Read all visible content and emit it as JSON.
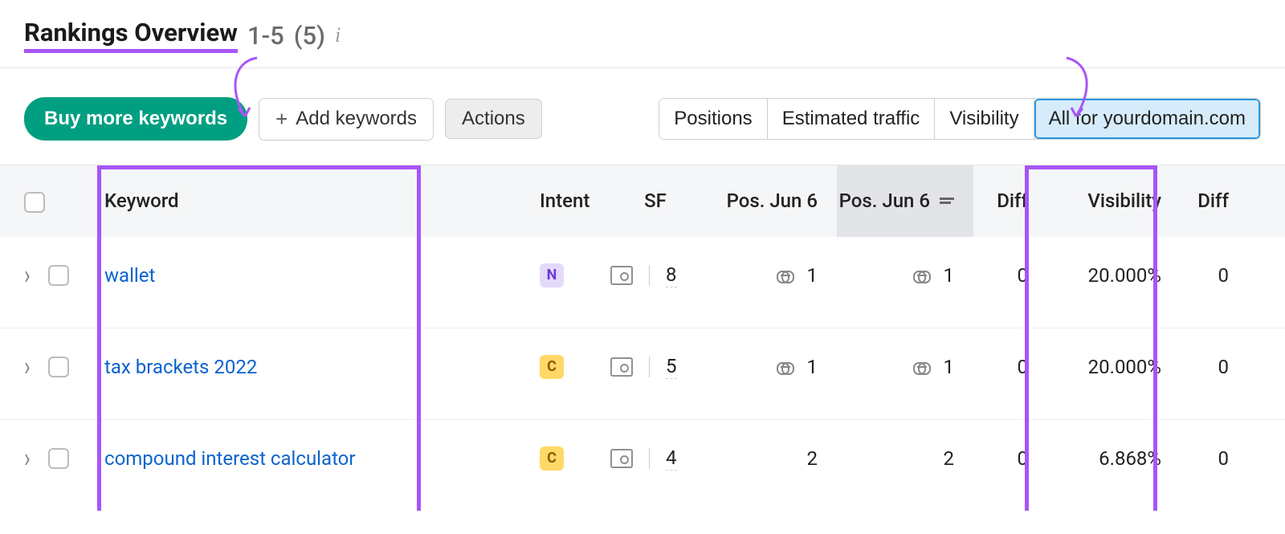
{
  "header": {
    "title": "Rankings Overview",
    "range": "1-5",
    "count": "(5)"
  },
  "toolbar": {
    "buy_label": "Buy more keywords",
    "add_label": "Add keywords",
    "actions_label": "Actions"
  },
  "tabs": {
    "positions": "Positions",
    "traffic": "Estimated traffic",
    "visibility": "Visibility",
    "allfor": "All for yourdomain.com"
  },
  "columns": {
    "keyword": "Keyword",
    "intent": "Intent",
    "sf": "SF",
    "pos1": "Pos. Jun 6",
    "pos2": "Pos. Jun 6",
    "diff": "Diff",
    "visibility": "Visibility",
    "diff2": "Diff"
  },
  "rows": [
    {
      "keyword": "wallet",
      "intent": "N",
      "sf": "8",
      "pos1": "1",
      "pos1_link": true,
      "pos2": "1",
      "pos2_link": true,
      "diff": "0",
      "visibility": "20.000%",
      "diff2": "0"
    },
    {
      "keyword": "tax brackets 2022",
      "intent": "C",
      "sf": "5",
      "pos1": "1",
      "pos1_link": true,
      "pos2": "1",
      "pos2_link": true,
      "diff": "0",
      "visibility": "20.000%",
      "diff2": "0"
    },
    {
      "keyword": "compound interest calculator",
      "intent": "C",
      "sf": "4",
      "pos1": "2",
      "pos1_link": false,
      "pos2": "2",
      "pos2_link": false,
      "diff": "0",
      "visibility": "6.868%",
      "diff2": "0"
    }
  ]
}
